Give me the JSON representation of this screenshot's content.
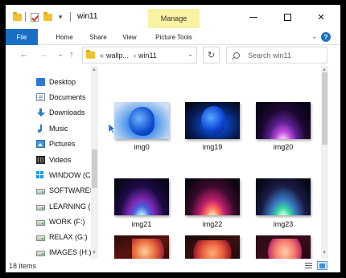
{
  "window": {
    "title": "win11",
    "manage_tab": "Manage",
    "controls": {
      "minimize": "minimize",
      "maximize": "maximize",
      "close": "✕"
    }
  },
  "ribbon": {
    "tabs": [
      "File",
      "Home",
      "Share",
      "View",
      "Picture Tools"
    ],
    "help": "?"
  },
  "navigation": {
    "back": "←",
    "forward": "→",
    "recent": "⌄",
    "up": "↑",
    "breadcrumb_prefix": "«",
    "breadcrumbs": [
      "wallp...",
      "win11"
    ],
    "breadcrumb_sep": "›",
    "refresh": "↻",
    "search_placeholder": "Search win11"
  },
  "nav_pane": {
    "items": [
      {
        "label": "Desktop",
        "icon": "desktop-icon"
      },
      {
        "label": "Documents",
        "icon": "documents-icon"
      },
      {
        "label": "Downloads",
        "icon": "downloads-icon"
      },
      {
        "label": "Music",
        "icon": "music-icon"
      },
      {
        "label": "Pictures",
        "icon": "pictures-icon"
      },
      {
        "label": "Videos",
        "icon": "videos-icon"
      },
      {
        "label": "WINDOW (C",
        "icon": "windows-drive-icon"
      },
      {
        "label": "SOFTWARES",
        "icon": "drive-icon"
      },
      {
        "label": "LEARNING (",
        "icon": "drive-icon"
      },
      {
        "label": "WORK (F:)",
        "icon": "drive-icon"
      },
      {
        "label": "RELAX (G:)",
        "icon": "drive-icon"
      },
      {
        "label": "IMAGES (H:)",
        "icon": "drive-icon"
      }
    ]
  },
  "files": [
    {
      "name": "img0"
    },
    {
      "name": "img19"
    },
    {
      "name": "img20"
    },
    {
      "name": "img21"
    },
    {
      "name": "img22"
    },
    {
      "name": "img23"
    },
    {
      "name": ""
    },
    {
      "name": ""
    },
    {
      "name": ""
    }
  ],
  "status": {
    "item_count": "18 items"
  }
}
